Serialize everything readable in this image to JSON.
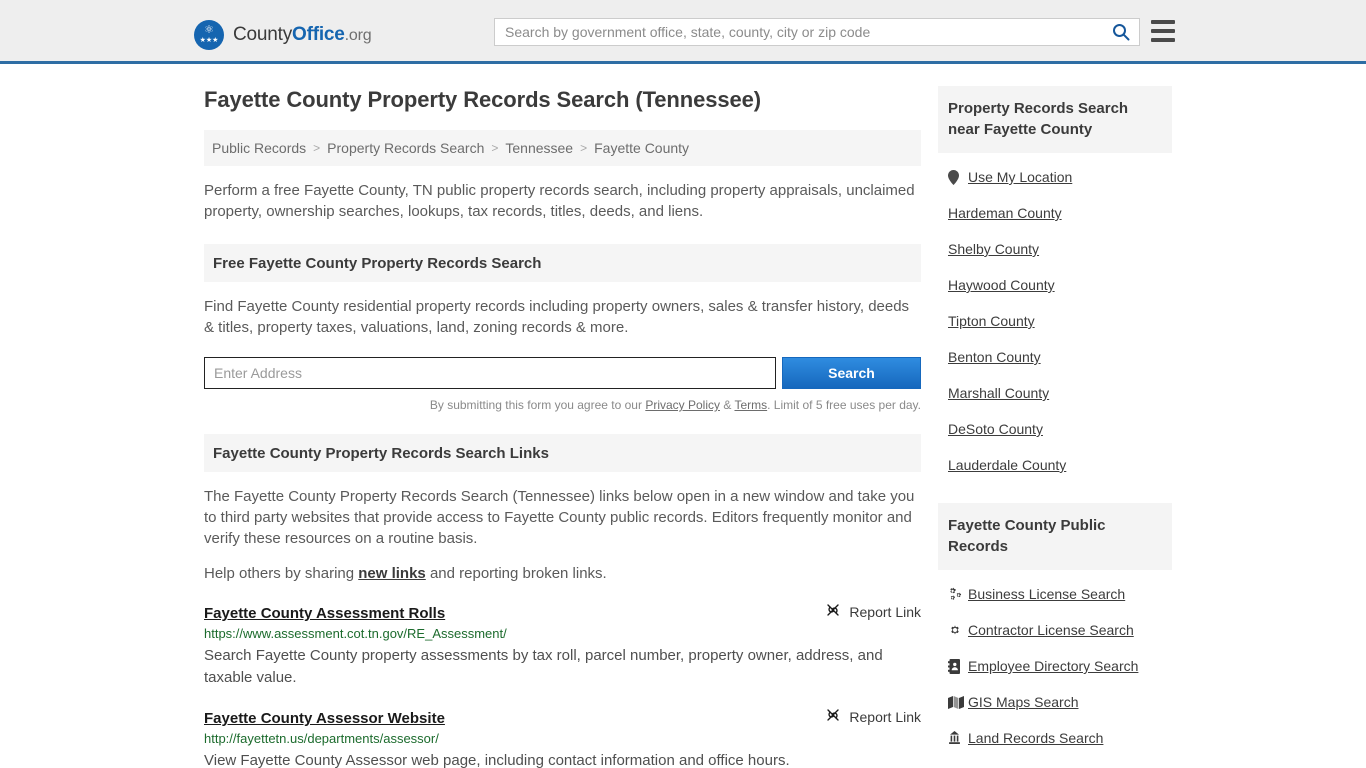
{
  "header": {
    "brand": {
      "part1": "County",
      "part2": "Office",
      "part3": ".org",
      "icon": "eagle-seal-logo"
    },
    "search": {
      "placeholder": "Search by government office, state, county, city or zip code",
      "value": "",
      "icon": "search-icon"
    },
    "menu_icon": "hamburger-menu-icon"
  },
  "main": {
    "title": "Fayette County Property Records Search (Tennessee)",
    "breadcrumb": [
      {
        "label": "Public Records"
      },
      {
        "label": "Property Records Search"
      },
      {
        "label": "Tennessee"
      },
      {
        "label": "Fayette County"
      }
    ],
    "breadcrumb_separator": ">",
    "intro": "Perform a free Fayette County, TN public property records search, including property appraisals, unclaimed property, ownership searches, lookups, tax records, titles, deeds, and liens.",
    "free_search": {
      "heading": "Free Fayette County Property Records Search",
      "description": "Find Fayette County residential property records including property owners, sales & transfer history, deeds & titles, property taxes, valuations, land, zoning records & more.",
      "address_placeholder": "Enter Address",
      "address_value": "",
      "search_button": "Search",
      "legal_prefix": "By submitting this form you agree to our ",
      "legal_privacy": "Privacy Policy",
      "legal_amp": " & ",
      "legal_terms": "Terms",
      "legal_suffix": ". Limit of 5 free uses per day."
    },
    "links_section": {
      "heading": "Fayette County Property Records Search Links",
      "paragraph": "The Fayette County Property Records Search (Tennessee) links below open in a new window and take you to third party websites that provide access to Fayette County public records. Editors frequently monitor and verify these resources on a routine basis.",
      "help_prefix": "Help others by sharing ",
      "help_link": "new links",
      "help_suffix": " and reporting broken links.",
      "report_label": "Report Link",
      "report_icon": "broken-link-icon"
    },
    "results": [
      {
        "title": "Fayette County Assessment Rolls",
        "url": "https://www.assessment.cot.tn.gov/RE_Assessment/",
        "description": "Search Fayette County property assessments by tax roll, parcel number, property owner, address, and taxable value."
      },
      {
        "title": "Fayette County Assessor Website",
        "url": "http://fayettetn.us/departments/assessor/",
        "description": "View Fayette County Assessor web page, including contact information and office hours."
      }
    ]
  },
  "sidebar": {
    "near_panel": {
      "heading": "Property Records Search near Fayette County",
      "items": [
        {
          "label": "Use My Location",
          "icon": "map-pin-icon"
        },
        {
          "label": "Hardeman County",
          "icon": ""
        },
        {
          "label": "Shelby County",
          "icon": ""
        },
        {
          "label": "Haywood County",
          "icon": ""
        },
        {
          "label": "Tipton County",
          "icon": ""
        },
        {
          "label": "Benton County",
          "icon": ""
        },
        {
          "label": "Marshall County",
          "icon": ""
        },
        {
          "label": "DeSoto County",
          "icon": ""
        },
        {
          "label": "Lauderdale County",
          "icon": ""
        }
      ]
    },
    "public_records_panel": {
      "heading": "Fayette County Public Records",
      "items": [
        {
          "label": "Business License Search",
          "icon": "cogs-icon"
        },
        {
          "label": "Contractor License Search",
          "icon": "cog-icon"
        },
        {
          "label": "Employee Directory Search",
          "icon": "address-book-icon"
        },
        {
          "label": "GIS Maps Search",
          "icon": "map-icon"
        },
        {
          "label": "Land Records Search",
          "icon": "landmark-icon"
        }
      ]
    }
  },
  "colors": {
    "brand_blue": "#1565b0",
    "header_rule": "#2e6da4",
    "header_bg": "#eeeeee",
    "url_green": "#1c6b2d",
    "button_blue": "#1668bd",
    "section_bg": "#f5f5f5"
  }
}
